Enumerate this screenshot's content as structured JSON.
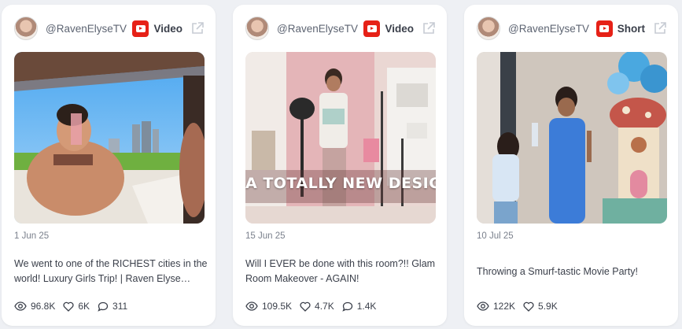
{
  "cards": [
    {
      "handle": "@RavenElyseTV",
      "type": "Video",
      "date": "1 Jun 25",
      "title": "We went to one of the RICHEST cities in the world! Luxury Girls Trip! | Raven Elyse…",
      "views": "96.8K",
      "likes": "6K",
      "comments": "311"
    },
    {
      "handle": "@RavenElyseTV",
      "type": "Video",
      "date": "15 Jun 25",
      "title": "Will I EVER be done with this room?!! Glam Room Makeover - AGAIN!",
      "thumb_text": "A TOTALLY NEW DESIGN!",
      "views": "109.5K",
      "likes": "4.7K",
      "comments": "1.4K"
    },
    {
      "handle": "@RavenElyseTV",
      "type": "Short",
      "date": "10 Jul 25",
      "title": "Throwing a Smurf-tastic Movie Party!",
      "views": "122K",
      "likes": "5.9K"
    }
  ],
  "icons": {
    "platform": "youtube-icon",
    "external": "external-link-icon",
    "views": "eye-icon",
    "likes": "heart-icon",
    "comments": "comment-icon"
  },
  "colors": {
    "background": "#eef0f4",
    "card": "#ffffff",
    "youtube_red": "#e62117",
    "text": "#3a3f4a",
    "muted": "#7a808c"
  }
}
